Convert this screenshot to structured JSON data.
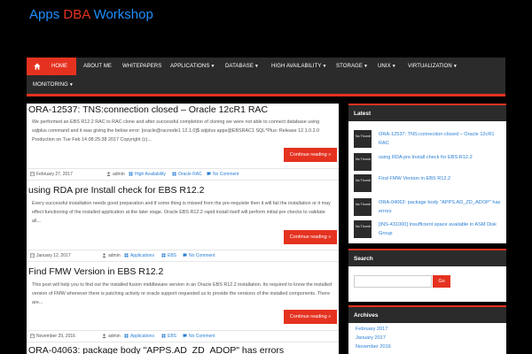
{
  "site": {
    "title_part1": "Apps",
    "title_part2": "DBA",
    "title_part3": "Workshop"
  },
  "nav": {
    "home": "HOME",
    "items": [
      {
        "label": "ABOUT ME"
      },
      {
        "label": "WHITEPAPERS"
      },
      {
        "label": "APPLICATIONS",
        "has_dropdown": true
      },
      {
        "label": "DATABASE",
        "has_dropdown": true
      },
      {
        "label": "HIGH AVAILABILITY",
        "has_dropdown": true
      },
      {
        "label": "STORAGE",
        "has_dropdown": true
      },
      {
        "label": "UNIX",
        "has_dropdown": true
      },
      {
        "label": "VIRTUALIZATION",
        "has_dropdown": true
      },
      {
        "label": "MONITORING",
        "has_dropdown": true
      }
    ],
    "caret": "▼"
  },
  "posts": [
    {
      "title": "ORA-12537: TNS:connection closed – Oracle 12cR1 RAC",
      "excerpt": "We performed an EBS R12.2 RAC to RAC clone and after successful completion of cloning we were not able to connect database using sqlplus command and it was giving the below error: [oracle@racnode1 12.1.0]$ sqlplus apps@EBSRAC1 SQL*Plus: Release 12.1.0.2.0 Production on Tue Feb 14 08:25:38 2017 Copyright (c)...",
      "read_more": "Continue reading »",
      "date": "February 27, 2017",
      "author": "admin",
      "categories": [
        "High Availability",
        "Oracle RAC"
      ],
      "comments": "No Comment"
    },
    {
      "title": "using RDA pre Install check for EBS R12.2",
      "excerpt": "Every successful installation needs good preparation and if some thing is missed from the pre-requisite then it will fail the installation or it may effect functioning of the installed application at the later stage. Oracle EBS R12.2 rapid install itself will perform initial pre checks to validate all...",
      "read_more": "Continue reading »",
      "date": "January 12, 2017",
      "author": "admin",
      "categories": [
        "Applications",
        "EBS"
      ],
      "comments": "No Comment"
    },
    {
      "title": "Find FMW Version in EBS R12.2",
      "excerpt": "This post will help you to find out the installed fusion middleware version in an Oracle EBS  R12.2 installation. Its required to know the installed version of FMW whenever there is patching activity or oracle support requested us to provide the versions of the installed components. There are...",
      "read_more": "Continue reading »",
      "date": "November 29, 2016",
      "author": "admin",
      "categories": [
        "Applications",
        "EBS"
      ],
      "comments": "No Comment"
    },
    {
      "title": "ORA-04063: package body \"APPS.AD_ZD_ADOP\" has errors"
    }
  ],
  "sidebar": {
    "latest": {
      "title": "Latest",
      "thumb_text": "No Thumb",
      "items": [
        "ORA-12537: TNS:connection closed – Oracle 12cR1 RAC",
        "using RDA pre Install check for EBS R12.2",
        "Find FMW Version in EBS R12.2",
        "ORA-04063: package body \"APPS.AD_ZD_ADOP\" has errors",
        "[INS-431000] Insufficient space available in ASM Disk Group"
      ]
    },
    "search": {
      "title": "Search",
      "button": "Go",
      "placeholder": ""
    },
    "archives": {
      "title": "Archives",
      "items": [
        "February 2017",
        "January 2017",
        "November 2016"
      ]
    }
  },
  "colors": {
    "accent": "#e53220",
    "link": "#2a7fd4",
    "nav_bg": "#2b2b2b",
    "page_bg": "#000000"
  }
}
